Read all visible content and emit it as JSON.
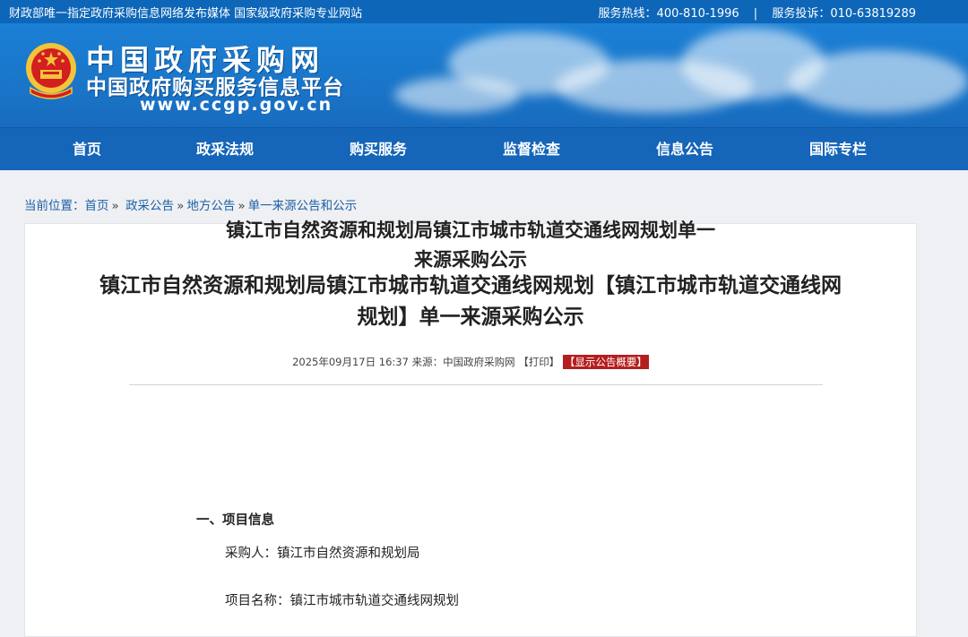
{
  "topbar": {
    "left_text": "财政部唯一指定政府采购信息网络发布媒体 国家级政府采购专业网站",
    "hotline": "服务热线：400-810-1996",
    "separator": "|",
    "complaint": "服务投诉：010-63819289"
  },
  "banner": {
    "name_line1": "中国政府采购网",
    "name_line2": "中国政府购买服务信息平台",
    "url": "www.ccgp.gov.cn"
  },
  "nav": {
    "items": [
      {
        "label": "首页"
      },
      {
        "label": "政采法规"
      },
      {
        "label": "购买服务"
      },
      {
        "label": "监督检查"
      },
      {
        "label": "信息公告"
      },
      {
        "label": "国际专栏"
      }
    ]
  },
  "breadcrumb": {
    "label": "当前位置：",
    "items": [
      "首页",
      "政采公告",
      "地方公告",
      "单一来源公告和公示"
    ],
    "sep": "»"
  },
  "article": {
    "title_line1": "镇江市自然资源和规划局镇江市城市轨道交通线网规划【镇江市城市轨道交通线网",
    "title_line2": "规划】单一来源采购公示",
    "meta_date": "2025年09月17日 16:37",
    "meta_source": "来源：中国政府采购网",
    "print_label": "【打印】",
    "summary_label": "【显示公告概要】",
    "doc_title_line1": "镇江市自然资源和规划局镇江市城市轨道交通线网规划单一",
    "doc_title_line2": "来源采购公示",
    "section_1": "一、项目信息",
    "purchaser": "采购人：镇江市自然资源和规划局",
    "project_name": "项目名称：镇江市城市轨道交通线网规划"
  },
  "colors": {
    "brand_blue": "#1565b8",
    "summary_red": "#b51e1e"
  }
}
